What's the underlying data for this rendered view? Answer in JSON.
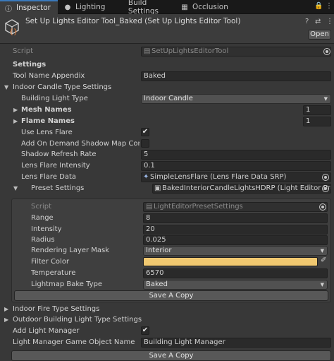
{
  "tabs": [
    {
      "label": "Inspector",
      "icon": "info-icon"
    },
    {
      "label": "Lighting",
      "icon": "lightbulb-icon"
    },
    {
      "label": "Build Settings",
      "icon": ""
    },
    {
      "label": "Occlusion",
      "icon": "occlusion-icon"
    }
  ],
  "window_icons": {
    "lock": "🔒",
    "menu": "⋮"
  },
  "header": {
    "title": "Set Up Lights Editor Tool_Baked (Set Up Lights Editor Tool)",
    "open_label": "Open",
    "help_icon": "?",
    "settings_icon": "⇄",
    "more_icon": "⋮"
  },
  "script_row": {
    "label": "Script",
    "value": "SetUpLightsEditorTool"
  },
  "settings": {
    "title": "Settings",
    "tool_name_appendix_label": "Tool Name Appendix",
    "tool_name_appendix_value": "Baked"
  },
  "indoor_candle": {
    "title": "Indoor Candle Type Settings",
    "building_light_type_label": "Building Light Type",
    "building_light_type_value": "Indoor Candle",
    "mesh_names_label": "Mesh Names",
    "mesh_names_count": "1",
    "flame_names_label": "Flame Names",
    "flame_names_count": "1",
    "use_lens_flare_label": "Use Lens Flare",
    "use_lens_flare_checked": "✔",
    "add_on_demand_label": "Add On Demand Shadow Map Compo",
    "shadow_refresh_rate_label": "Shadow Refresh Rate",
    "shadow_refresh_rate_value": "5",
    "lens_flare_intensity_label": "Lens Flare Intensity",
    "lens_flare_intensity_value": "0.1",
    "lens_flare_data_label": "Lens Flare Data",
    "lens_flare_data_value": "SimpleLensFlare (Lens Flare Data SRP)",
    "preset_settings_label": "Preset Settings",
    "preset_settings_value": "BakedInteriorCandleLightsHDRP (Light Editor Prese"
  },
  "preset": {
    "script_label": "Script",
    "script_value": "LightEditorPresetSettings",
    "range_label": "Range",
    "range_value": "8",
    "intensity_label": "Intensity",
    "intensity_value": "20",
    "radius_label": "Radius",
    "radius_value": "0.025",
    "rendering_layer_mask_label": "Rendering Layer Mask",
    "rendering_layer_mask_value": "Interior",
    "filter_color_label": "Filter Color",
    "filter_color_value": "#f0c870",
    "temperature_label": "Temperature",
    "temperature_value": "6570",
    "lightmap_bake_type_label": "Lightmap Bake Type",
    "lightmap_bake_type_value": "Baked",
    "save_copy_label": "Save A Copy"
  },
  "footer": {
    "indoor_fire_label": "Indoor Fire Type Settings",
    "outdoor_building_label": "Outdoor Building Light Type Settings",
    "add_light_manager_label": "Add Light Manager",
    "add_light_manager_checked": "✔",
    "light_manager_name_label": "Light Manager Game Object Name",
    "light_manager_name_value": "Building Light Manager",
    "save_copy_label": "Save A Copy"
  },
  "glyphs": {
    "foldout_open": "▼",
    "foldout_closed": "▶",
    "dropdown_arrow": "▼",
    "eyedropper": "✐",
    "lens_flare_icon": "✦",
    "preset_icon": "▣",
    "script_icon": "▤"
  },
  "colors": {
    "accent": "#3a79bb",
    "panel": "#383838",
    "field": "#2a2a2a"
  }
}
